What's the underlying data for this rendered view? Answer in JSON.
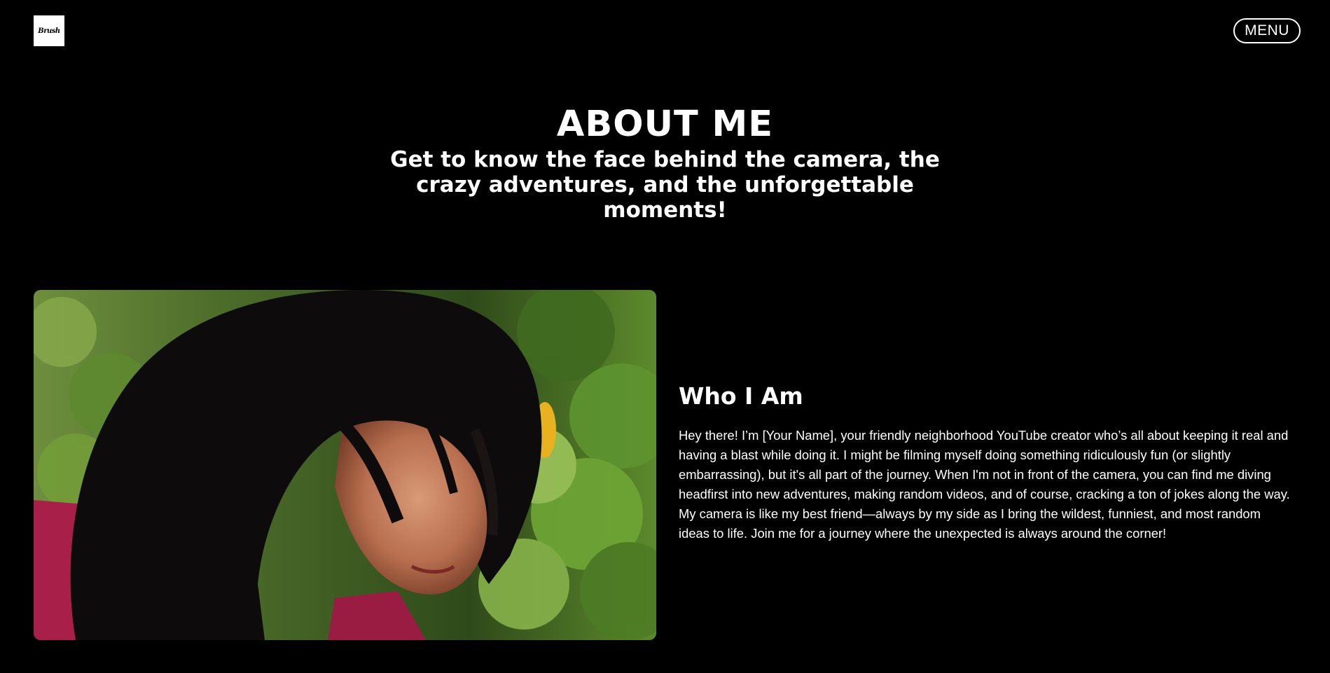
{
  "header": {
    "logo_text": "Brush",
    "menu_label": "MENU"
  },
  "hero": {
    "title": "ABOUT ME",
    "subtitle": "Get to know the face behind the camera, the crazy adventures, and the unforgettable moments!"
  },
  "about": {
    "heading": "Who I Am",
    "body": "Hey there! I’m [Your Name], your friendly neighborhood YouTube creator who’s all about keeping it real and having a blast while doing it. I might be filming myself doing something ridiculously fun (or slightly embarrassing), but it's all part of the journey. When I'm not in front of the camera, you can find me diving headfirst into new adventures, making random videos, and of course, cracking a ton of jokes along the way. My camera is like my best friend—always by my side as I bring the wildest, funniest, and most random ideas to life. Join me for a journey where the unexpected is always around the corner!"
  },
  "colors": {
    "background": "#000000",
    "text": "#ffffff",
    "foliage": "#4f7a2a",
    "shirt": "#a8204a",
    "hair": "#0d0b0c"
  }
}
